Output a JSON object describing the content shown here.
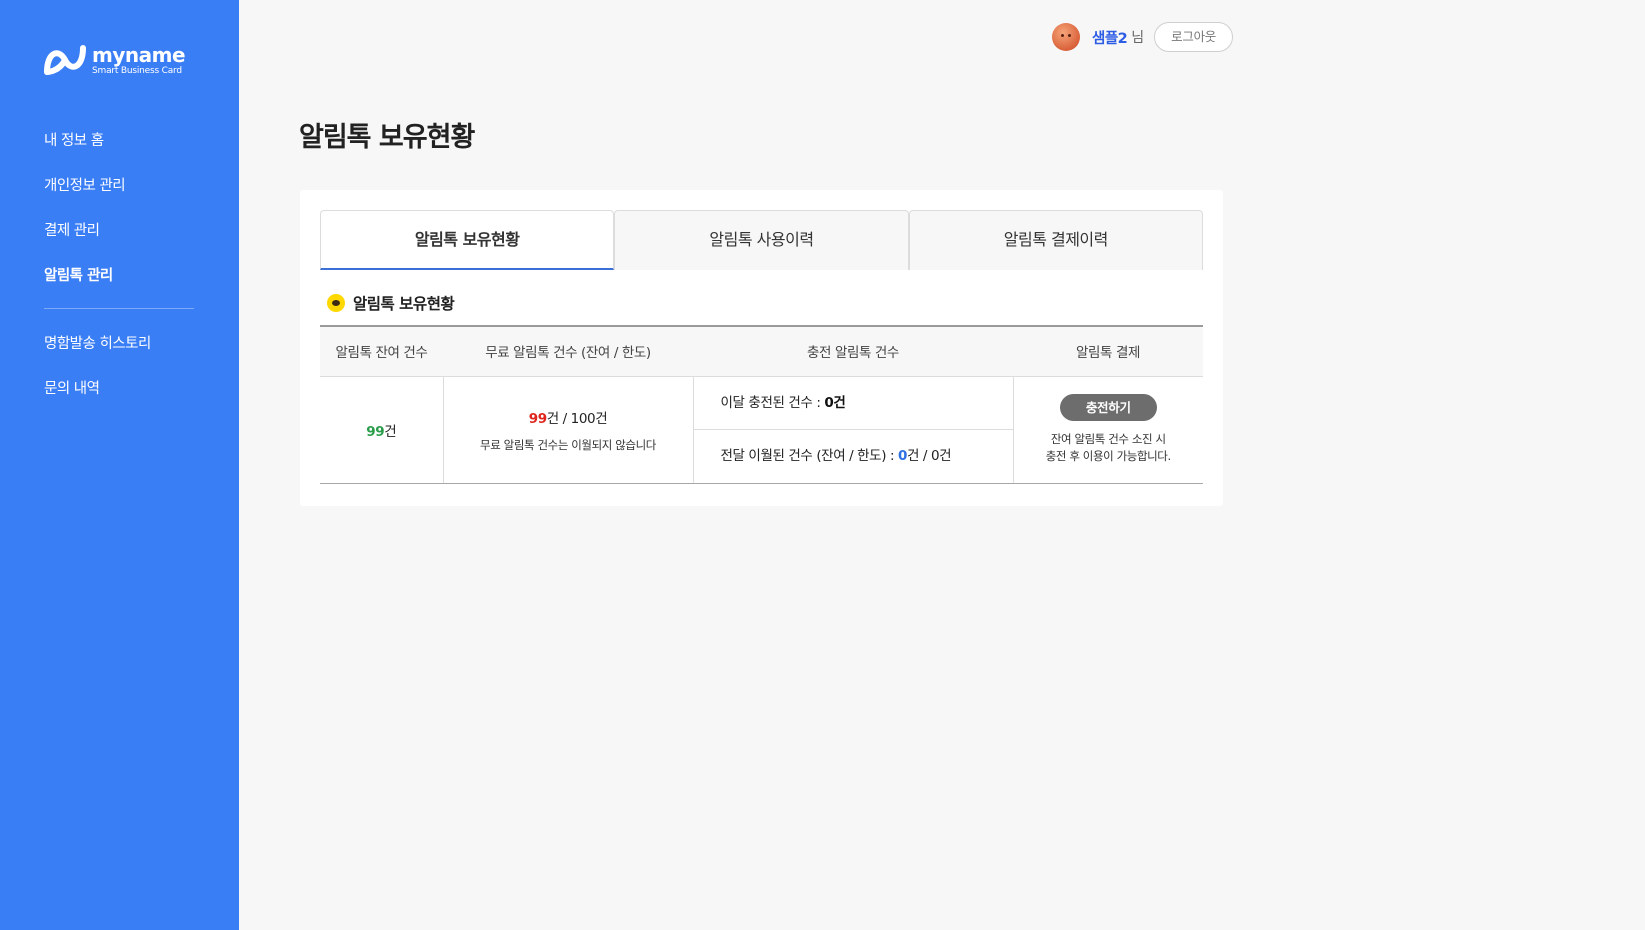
{
  "brand": {
    "word": "myname",
    "tagline": "Smart Business Card"
  },
  "sidebar": {
    "items": [
      {
        "label": "내 정보 홈"
      },
      {
        "label": "개인정보 관리"
      },
      {
        "label": "결제 관리"
      },
      {
        "label": "알림톡 관리",
        "active": true
      },
      {
        "label": "명함발송 히스토리"
      },
      {
        "label": "문의 내역"
      }
    ]
  },
  "header": {
    "user_name": "샘플2",
    "user_suffix": "님",
    "logout_label": "로그아웃"
  },
  "page": {
    "title": "알림톡 보유현황"
  },
  "tabs": [
    {
      "label": "알림톡 보유현황",
      "active": true
    },
    {
      "label": "알림톡 사용이력"
    },
    {
      "label": "알림톡 결제이력"
    }
  ],
  "section": {
    "title": "알림톡 보유현황"
  },
  "table": {
    "headers": [
      "알림톡 잔여 건수",
      "무료 알림톡 건수 (잔여 / 한도)",
      "충전 알림톡 건수",
      "알림톡 결제"
    ],
    "remaining": {
      "value": "99",
      "unit": "건"
    },
    "free": {
      "value": "99",
      "unit": "건",
      "limit": "/ 100건",
      "note": "무료 알림톡 건수는 이월되지 않습니다"
    },
    "charged": {
      "this_month_label": "이달 충전된 건수 :",
      "this_month_value": "0건",
      "carried_label": "전달 이월된 건수 (잔여 / 한도) :",
      "carried_value": "0",
      "carried_rest": "건 / 0건"
    },
    "payment": {
      "button_label": "충전하기",
      "note_line1": "잔여 알림톡 건수 소진 시",
      "note_line2": "충전 후 이용이 가능합니다."
    }
  },
  "colors": {
    "sidebar": "#3a7ef6",
    "accent": "#2d5ce5",
    "green": "#2a9d4a",
    "red": "#e0261c"
  }
}
